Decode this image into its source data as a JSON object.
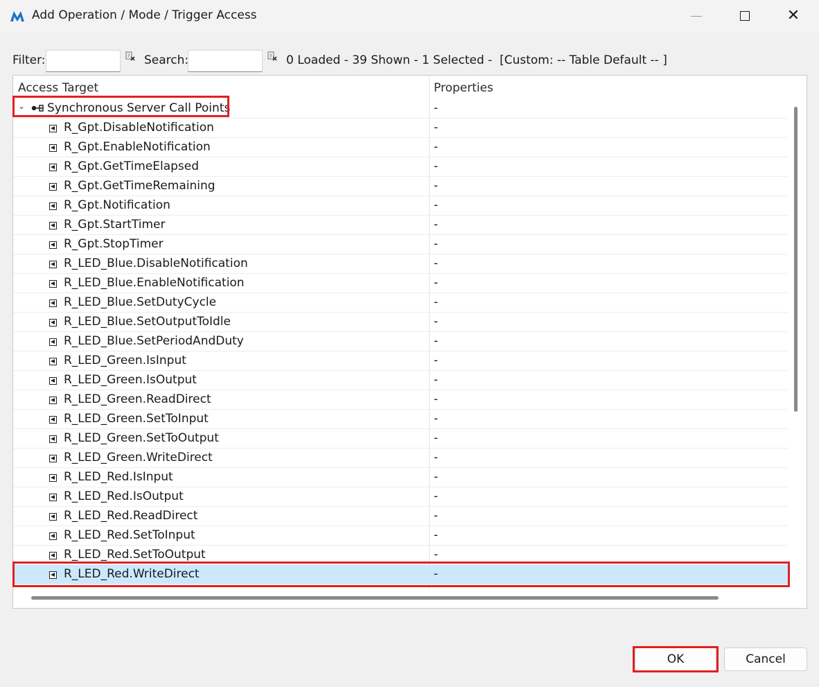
{
  "window": {
    "title": "Add Operation / Mode / Trigger Access",
    "minimize_icon": "minimize-icon",
    "maximize_icon": "maximize-icon",
    "close_icon": "close-icon",
    "close_glyph": "✕"
  },
  "filterbar": {
    "filter_label": "Filter:",
    "filter_value": "",
    "search_label": "Search:",
    "search_value": "",
    "status": "0 Loaded - 39 Shown - 1 Selected -  [Custom: -- Table Default -- ]"
  },
  "table": {
    "headers": [
      "Access Target",
      "Properties"
    ],
    "group": {
      "label": "Synchronous Server Call Points",
      "value": "-",
      "expand_glyph": "⌄"
    },
    "rows": [
      {
        "name": "R_Gpt.DisableNotification",
        "prop": "-"
      },
      {
        "name": "R_Gpt.EnableNotification",
        "prop": "-"
      },
      {
        "name": "R_Gpt.GetTimeElapsed",
        "prop": "-"
      },
      {
        "name": "R_Gpt.GetTimeRemaining",
        "prop": "-"
      },
      {
        "name": "R_Gpt.Notification",
        "prop": "-"
      },
      {
        "name": "R_Gpt.StartTimer",
        "prop": "-"
      },
      {
        "name": "R_Gpt.StopTimer",
        "prop": "-"
      },
      {
        "name": "R_LED_Blue.DisableNotification",
        "prop": "-"
      },
      {
        "name": "R_LED_Blue.EnableNotification",
        "prop": "-"
      },
      {
        "name": "R_LED_Blue.SetDutyCycle",
        "prop": "-"
      },
      {
        "name": "R_LED_Blue.SetOutputToIdle",
        "prop": "-"
      },
      {
        "name": "R_LED_Blue.SetPeriodAndDuty",
        "prop": "-"
      },
      {
        "name": "R_LED_Green.IsInput",
        "prop": "-"
      },
      {
        "name": "R_LED_Green.IsOutput",
        "prop": "-"
      },
      {
        "name": "R_LED_Green.ReadDirect",
        "prop": "-"
      },
      {
        "name": "R_LED_Green.SetToInput",
        "prop": "-"
      },
      {
        "name": "R_LED_Green.SetToOutput",
        "prop": "-"
      },
      {
        "name": "R_LED_Green.WriteDirect",
        "prop": "-"
      },
      {
        "name": "R_LED_Red.IsInput",
        "prop": "-"
      },
      {
        "name": "R_LED_Red.IsOutput",
        "prop": "-"
      },
      {
        "name": "R_LED_Red.ReadDirect",
        "prop": "-"
      },
      {
        "name": "R_LED_Red.SetToInput",
        "prop": "-"
      },
      {
        "name": "R_LED_Red.SetToOutput",
        "prop": "-"
      },
      {
        "name": "R_LED_Red.WriteDirect",
        "prop": "-",
        "selected": true
      }
    ]
  },
  "buttons": {
    "ok": "OK",
    "cancel": "Cancel"
  },
  "colors": {
    "selection": "#cce8ff",
    "highlight": "#e02020",
    "brand": "#1a73c8"
  }
}
